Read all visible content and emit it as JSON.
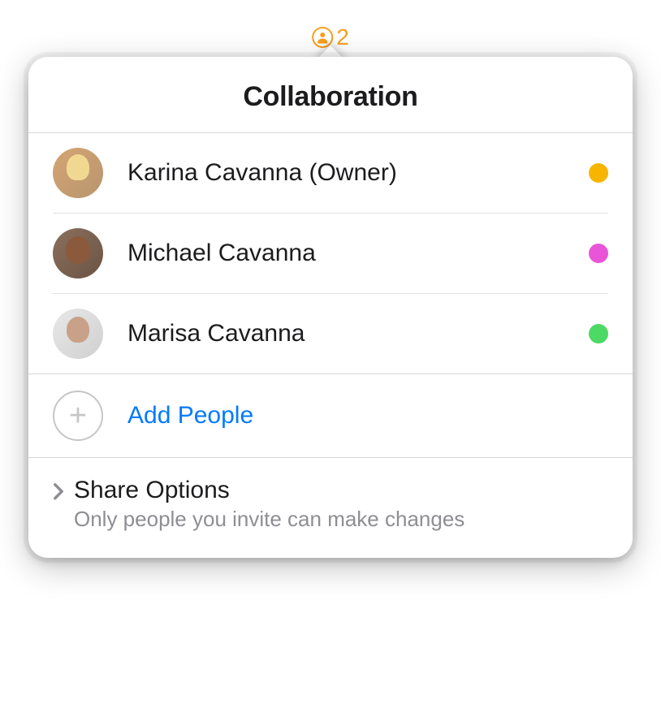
{
  "indicator": {
    "count": "2",
    "icon_name": "person-circle-icon"
  },
  "popover": {
    "title": "Collaboration",
    "participants": [
      {
        "name": "Karina Cavanna (Owner)",
        "status_color": "#f7b500",
        "avatar_class": "avatar-1"
      },
      {
        "name": "Michael Cavanna",
        "status_color": "#e855d8",
        "avatar_class": "avatar-2"
      },
      {
        "name": "Marisa Cavanna",
        "status_color": "#4cd964",
        "avatar_class": "avatar-3"
      }
    ],
    "add_people_label": "Add People",
    "share_options": {
      "title": "Share Options",
      "subtitle": "Only people you invite can make changes"
    }
  }
}
